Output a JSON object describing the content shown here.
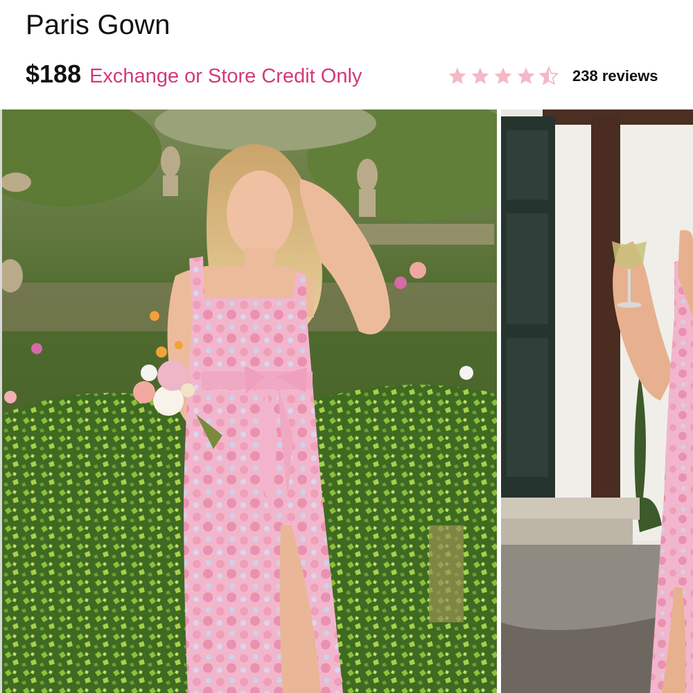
{
  "product": {
    "title": "Paris Gown",
    "price": "$188",
    "policy": "Exchange or Store Credit Only",
    "rating": 4.5,
    "reviews_label": "238 reviews"
  },
  "colors": {
    "accent": "#d2397a",
    "star": "#f4b8c6"
  },
  "gallery": {
    "photos": [
      "model-in-garden-photo",
      "model-with-glass-photo"
    ]
  }
}
